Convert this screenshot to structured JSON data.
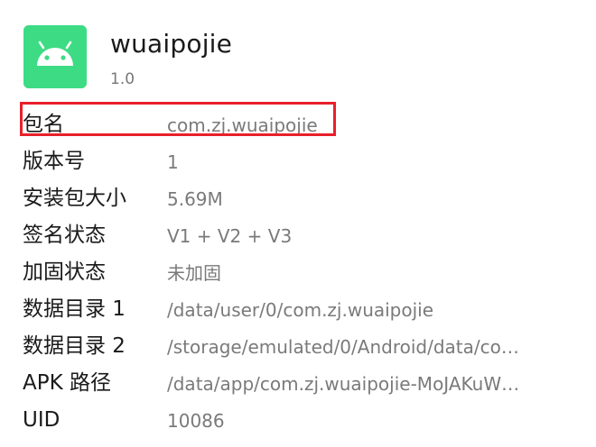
{
  "app": {
    "name": "wuaipojie",
    "version": "1.0",
    "icon": "android-icon",
    "icon_color": "#3ddc84"
  },
  "info_rows": [
    {
      "label": "包名",
      "value": "com.zj.wuaipojie"
    },
    {
      "label": "版本号",
      "value": "1"
    },
    {
      "label": "安装包大小",
      "value": "5.69M"
    },
    {
      "label": "签名状态",
      "value": "V1 + V2 + V3"
    },
    {
      "label": "加固状态",
      "value": "未加固"
    },
    {
      "label": "数据目录 1",
      "value": "/data/user/0/com.zj.wuaipojie"
    },
    {
      "label": "数据目录 2",
      "value": "/storage/emulated/0/Android/data/co…"
    },
    {
      "label": "APK 路径",
      "value": "/data/app/com.zj.wuaipojie-MoJAKuW…"
    },
    {
      "label": "UID",
      "value": "10086"
    }
  ],
  "highlight_color": "#e8202a"
}
